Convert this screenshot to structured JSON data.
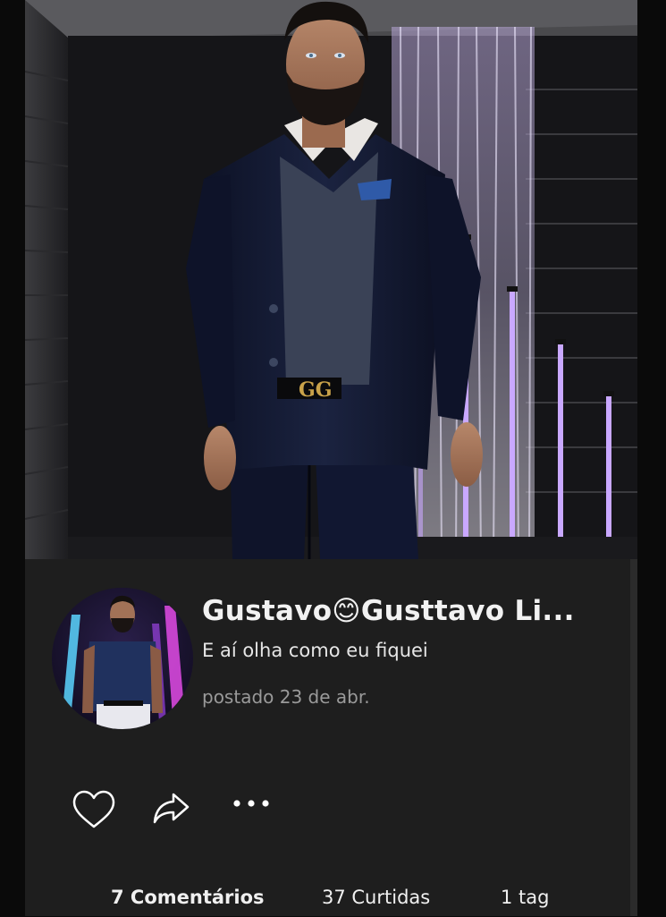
{
  "post": {
    "author": "Gustavo😊Gusttavo Li...",
    "caption": "E aí olha como eu fiquei",
    "posted": "postado 23 de abr."
  },
  "actions": {
    "like_icon": "heart-outline-icon",
    "share_icon": "share-arrow-icon",
    "more_icon": "ellipsis-icon"
  },
  "stats": {
    "comments": "7 Comentários",
    "likes": "37 Curtidas",
    "tags": "1 tag"
  },
  "colors": {
    "panel": "#1e1e1e",
    "text": "#f2f2f2",
    "muted": "#9a9a9a",
    "accent_light": "#c9a8ff"
  }
}
